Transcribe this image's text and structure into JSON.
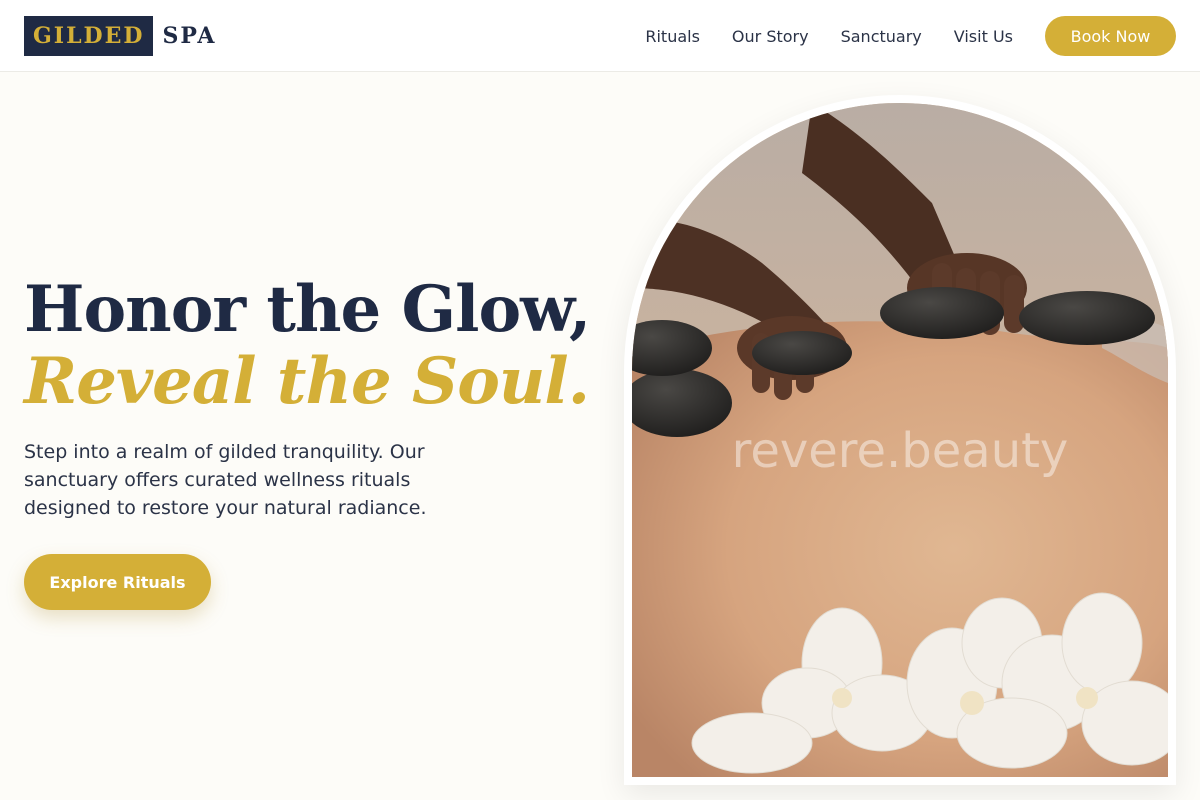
{
  "brand": {
    "logo_primary": "GILDED",
    "logo_secondary": "SPA"
  },
  "nav": {
    "links": [
      "Rituals",
      "Our Story",
      "Sanctuary",
      "Visit Us"
    ],
    "cta_label": "Book Now"
  },
  "hero": {
    "headline_line1": "Honor the Glow,",
    "headline_line2": "Reveal the Soul.",
    "subtext": "Step into a realm of gilded tranquility. Our sanctuary offers curated wellness rituals designed to restore your natural radiance.",
    "cta_label": "Explore Rituals",
    "image_watermark": "revere.beauty"
  },
  "colors": {
    "navy": "#1f2a44",
    "gold": "#d4af37",
    "background": "#fdfcf8",
    "header_background": "#ffffff"
  }
}
